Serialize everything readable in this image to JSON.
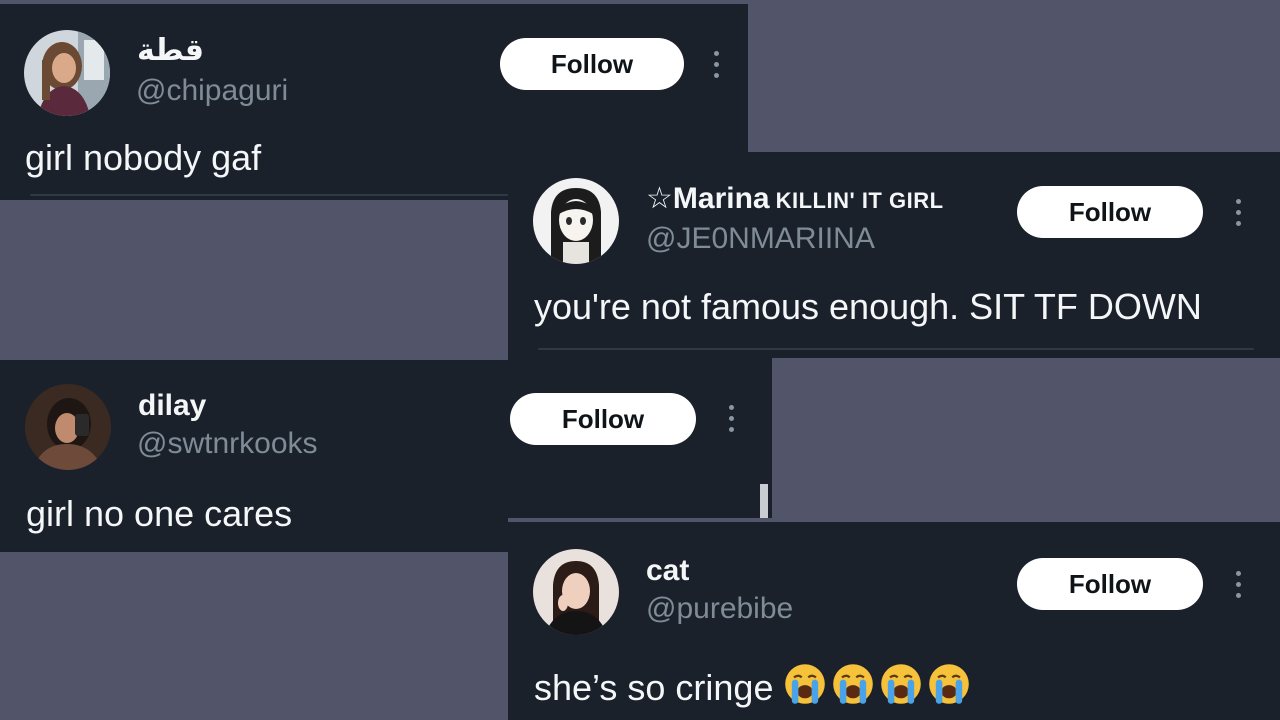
{
  "cards": [
    {
      "display_name": "قطة",
      "handle": "@chipaguri",
      "follow_label": "Follow",
      "text": "girl nobody gaf"
    },
    {
      "display_name": "☆Marina",
      "name_tag": "KILLIN' IT GIRL",
      "handle": "@JE0NMARIINA",
      "follow_label": "Follow",
      "text": "you're not famous enough. SIT TF DOWN"
    },
    {
      "display_name": "dilay",
      "handle": "@swtnrkooks",
      "follow_label": "Follow",
      "text": "girl no one cares"
    },
    {
      "display_name": "cat",
      "handle": "@purebibe",
      "follow_label": "Follow",
      "text": "she’s so cringe",
      "emoji_icons": [
        "loudly-crying-face-icon",
        "loudly-crying-face-icon",
        "loudly-crying-face-icon",
        "loudly-crying-face-icon"
      ]
    }
  ],
  "colors": {
    "background": "#525469",
    "card": "#1a212b",
    "text": "#f4f6f8",
    "handle": "#7f8b97",
    "button": "#ffffff"
  }
}
